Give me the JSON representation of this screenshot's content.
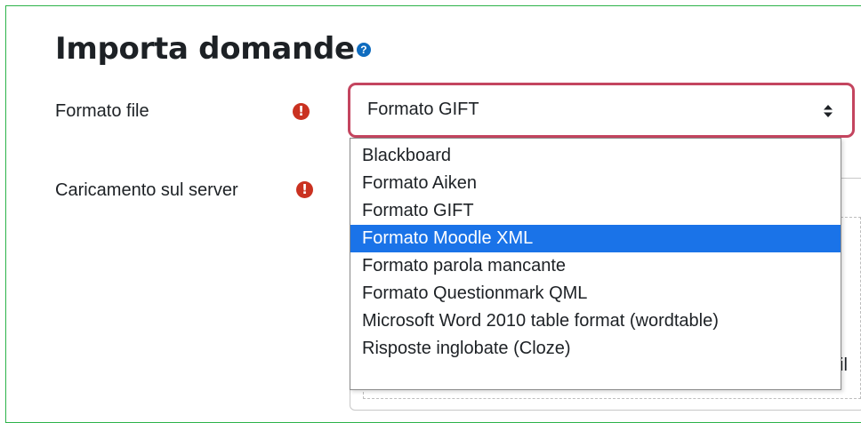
{
  "page": {
    "title": "Importa domande",
    "help_icon": "question-circle-icon"
  },
  "form": {
    "file_format": {
      "label": "Formato file",
      "required_icon": "exclamation-circle-icon",
      "selected_value": "Formato GIFT",
      "caret_icon": "up-down-caret-icon",
      "options": [
        "Blackboard",
        "Formato Aiken",
        "Formato GIFT",
        "Formato Moodle XML",
        "Formato parola mancante",
        "Formato Questionmark QML",
        "Microsoft Word 2010 table format (wordtable)",
        "Risposte inglobate (Cloze)"
      ],
      "highlighted_option": "Formato Moodle XML"
    },
    "upload": {
      "label": "Caricamento sul server",
      "required_icon": "exclamation-circle-icon",
      "partial_text": "il"
    }
  },
  "colors": {
    "frame_border": "#2db34a",
    "required": "#ca3120",
    "select_focus_border": "#c4455f",
    "highlight": "#1a73e8",
    "help": "#0f6cbf"
  }
}
